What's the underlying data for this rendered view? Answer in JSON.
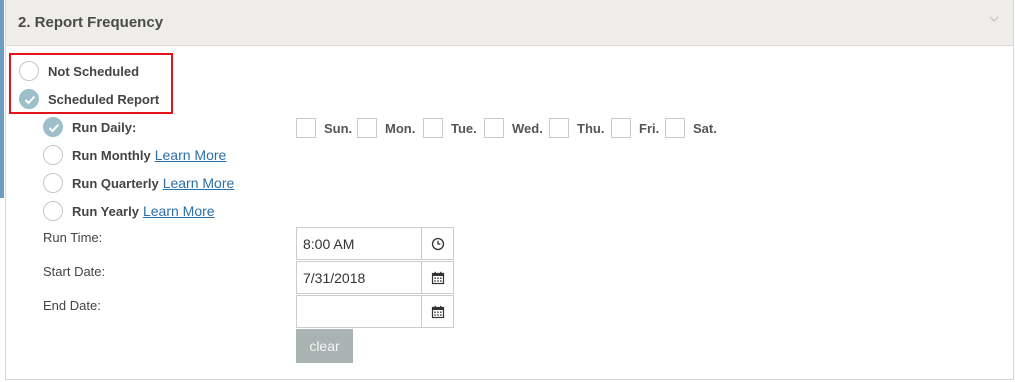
{
  "section": {
    "title": "2. Report Frequency",
    "collapse_icon": "chevron-down-icon"
  },
  "colors": {
    "header_bg": "#efede9",
    "highlight_border": "#e3151a",
    "radio_checked": "#9dbfca",
    "link": "#2a6fa8",
    "clear_button_bg": "#a9b3b1",
    "left_accent": "#6f9cc3"
  },
  "schedule_mode": {
    "options": [
      {
        "label": "Not Scheduled",
        "checked": false
      },
      {
        "label": "Scheduled Report",
        "checked": true
      }
    ]
  },
  "frequency": {
    "options": [
      {
        "label": "Run Daily:",
        "checked": true,
        "link": ""
      },
      {
        "label": "Run Monthly",
        "checked": false,
        "link": "Learn More"
      },
      {
        "label": "Run Quarterly",
        "checked": false,
        "link": "Learn More"
      },
      {
        "label": "Run Yearly",
        "checked": false,
        "link": "Learn More"
      }
    ]
  },
  "days": [
    {
      "label": "Sun.",
      "checked": false
    },
    {
      "label": "Mon.",
      "checked": false
    },
    {
      "label": "Tue.",
      "checked": false
    },
    {
      "label": "Wed.",
      "checked": false
    },
    {
      "label": "Thu.",
      "checked": false
    },
    {
      "label": "Fri.",
      "checked": false
    },
    {
      "label": "Sat.",
      "checked": false
    }
  ],
  "run_time": {
    "label": "Run Time:",
    "value": "8:00 AM",
    "icon": "clock-icon"
  },
  "start_date": {
    "label": "Start Date:",
    "value": "7/31/2018",
    "icon": "calendar-icon"
  },
  "end_date": {
    "label": "End Date:",
    "value": "",
    "icon": "calendar-icon"
  },
  "clear_button": {
    "label": "clear"
  }
}
